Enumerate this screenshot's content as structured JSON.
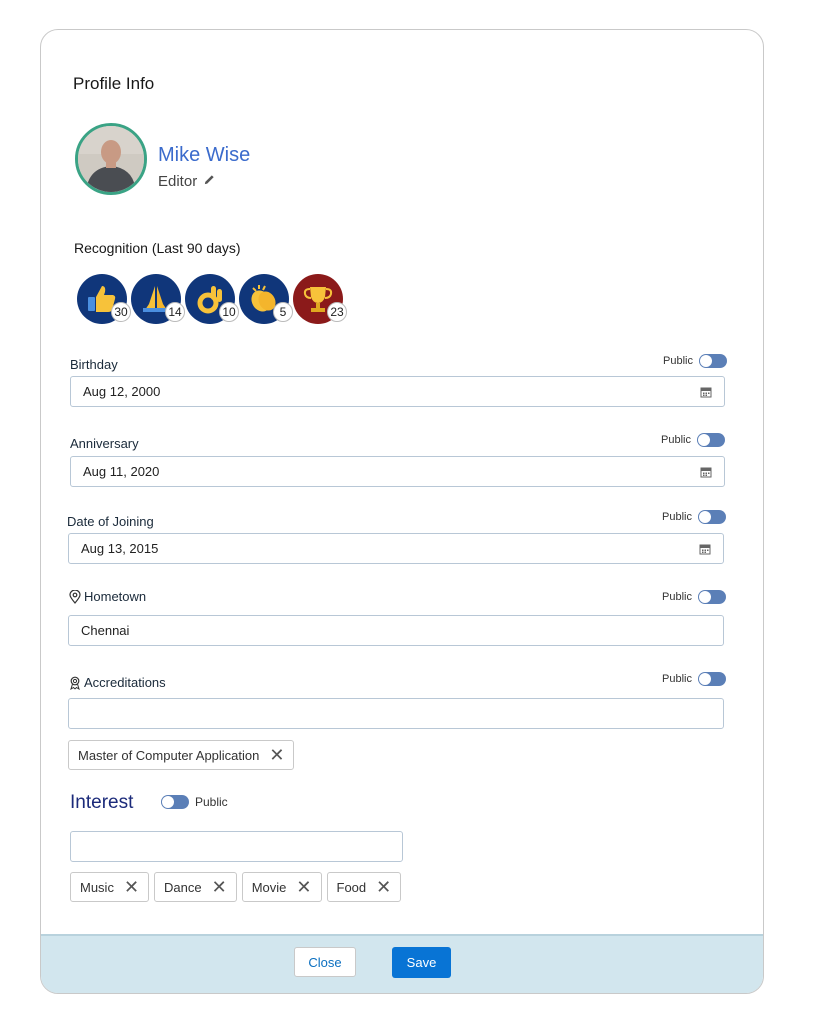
{
  "profile": {
    "title": "Profile Info",
    "name": "Mike Wise",
    "role": "Editor"
  },
  "recognition": {
    "title": "Recognition (Last 90 days)",
    "badges": [
      {
        "icon": "thumbs-up-icon",
        "count": "30",
        "bg": "#10367a"
      },
      {
        "icon": "praying-hands-icon",
        "count": "14",
        "bg": "#10367a"
      },
      {
        "icon": "ok-hand-icon",
        "count": "10",
        "bg": "#10367a"
      },
      {
        "icon": "clapping-hands-icon",
        "count": "5",
        "bg": "#10367a"
      },
      {
        "icon": "trophy-icon",
        "count": "23",
        "bg": "#8b1a1a"
      }
    ]
  },
  "public_label": "Public",
  "fields": {
    "birthday": {
      "label": "Birthday",
      "value": "Aug 12, 2000"
    },
    "anniversary": {
      "label": "Anniversary",
      "value": "Aug 11, 2020"
    },
    "joining": {
      "label": "Date of Joining",
      "value": "Aug 13, 2015"
    },
    "hometown": {
      "label": "Hometown",
      "value": "Chennai"
    },
    "accreditations": {
      "label": "Accreditations",
      "value": "",
      "tags": [
        "Master of Computer Application"
      ]
    }
  },
  "interest": {
    "title": "Interest",
    "value": "",
    "tags": [
      "Music",
      "Dance",
      "Movie",
      "Food"
    ]
  },
  "footer": {
    "close_label": "Close",
    "save_label": "Save"
  },
  "colors": {
    "accent": "#0874d5",
    "name": "#3b6bcc",
    "toggle": "#5b7fb7",
    "footer_bg": "#d2e6ee"
  }
}
